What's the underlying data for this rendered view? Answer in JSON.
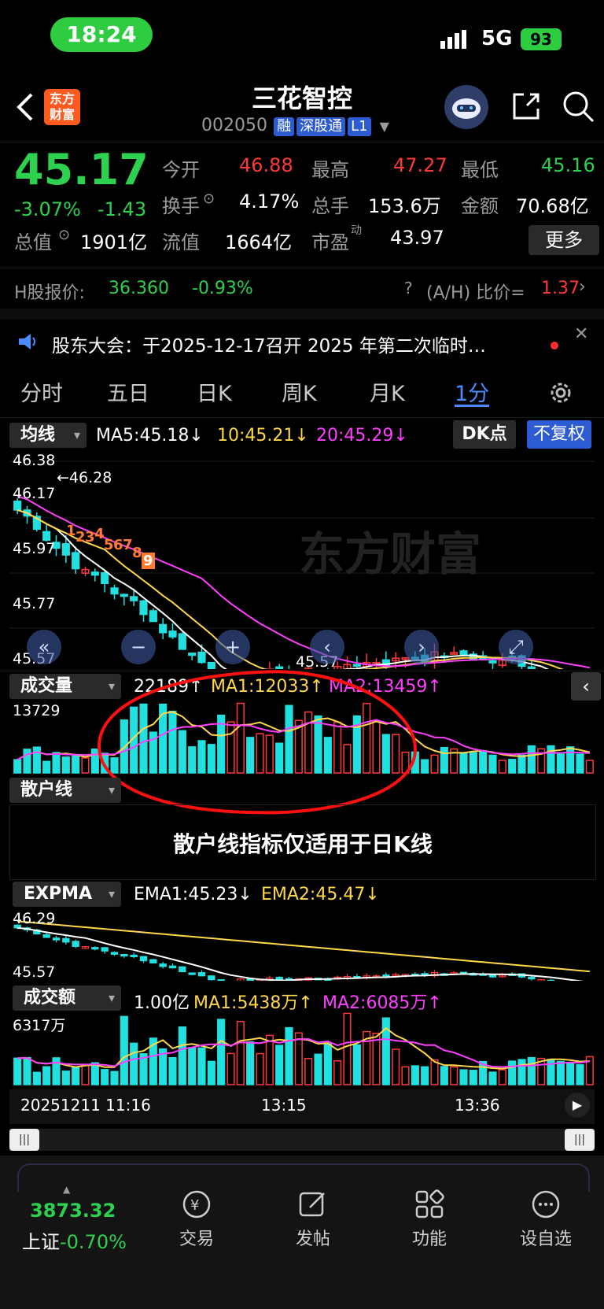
{
  "status_bar": {
    "time": "18:24",
    "network": "5G",
    "battery": "93"
  },
  "header": {
    "app_logo_text": "东方财富",
    "stock_name": "三花智控",
    "stock_code": "002050",
    "tags": [
      "融",
      "深股通",
      "L1"
    ]
  },
  "quote": {
    "price": "45.17",
    "change_pct": "-3.07%",
    "change": "-1.43",
    "stats": [
      [
        {
          "label": "今开",
          "value": "46.88"
        },
        {
          "label": "最高",
          "value": "47.27"
        },
        {
          "label": "最低",
          "value": "45.16"
        }
      ],
      [
        {
          "label": "换手",
          "value": "4.17%"
        },
        {
          "label": "总手",
          "value": "153.6万"
        },
        {
          "label": "金额",
          "value": "70.68亿"
        }
      ],
      [
        {
          "label": "总值",
          "value": "1901亿"
        },
        {
          "label": "流值",
          "value": "1664亿"
        },
        {
          "label": "市盈",
          "sup": "动",
          "value": "43.97"
        }
      ]
    ],
    "more_button": "更多"
  },
  "h_share": {
    "label": "H股报价:",
    "price": "36.360",
    "change_pct": "-0.93%",
    "ah_label": "(A/H) 比价=",
    "ah_value": "1.37"
  },
  "notice": {
    "text": "股东大会：于2025-12-17召开 2025 年第二次临时…"
  },
  "tabs": [
    "分时",
    "五日",
    "日K",
    "周K",
    "月K",
    "1分"
  ],
  "active_tab": "1分",
  "kline": {
    "indicator": "均线",
    "ma5": "MA5:45.18↓",
    "ma10": "10:45.21↓",
    "ma20": "20:45.29↓",
    "dk_button": "DK点",
    "adjust_button": "不复权",
    "price_labels": [
      "46.38",
      "46.17",
      "45.97",
      "45.77",
      "45.57"
    ],
    "high_label": "46.28",
    "low_label": "45.57",
    "td_counts": [
      "1",
      "2",
      "3",
      "4",
      "5",
      "6",
      "7",
      "8",
      "9"
    ],
    "watermark": "东方财富"
  },
  "volume": {
    "indicator": "成交量",
    "value": "22189↑",
    "ma1": "MA1:12033↑",
    "ma2": "MA2:13459↑",
    "max_label": "13729"
  },
  "retail": {
    "indicator": "散户线",
    "message": "散户线指标仅适用于日K线"
  },
  "expma": {
    "indicator": "EXPMA",
    "ema1": "EMA1:45.23↓",
    "ema2": "EMA2:45.47↓",
    "top_label": "46.29",
    "bottom_label": "45.57"
  },
  "amount": {
    "indicator": "成交额",
    "value": "1.00亿",
    "ma1": "MA1:5438万↑",
    "ma2": "MA2:6085万↑",
    "max_label": "6317万"
  },
  "time_axis": [
    "20251211 11:16",
    "13:15",
    "13:36"
  ],
  "bottom_nav": {
    "index_value": "3873.32",
    "index_name": "上证",
    "index_change": "-0.70%",
    "items": [
      "交易",
      "发帖",
      "功能",
      "设自选"
    ]
  },
  "colors": {
    "up": "#ff3838",
    "down": "#2ed14f",
    "candle_down": "#22e0e0",
    "ma5": "#ffffff",
    "ma10": "#ffd84a",
    "ma20": "#ff3fff",
    "accent": "#2d5bd1"
  }
}
